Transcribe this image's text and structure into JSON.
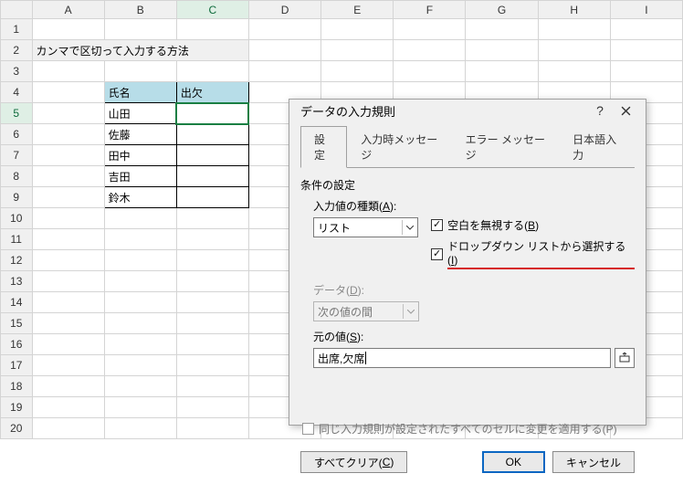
{
  "columns": [
    "A",
    "B",
    "C",
    "D",
    "E",
    "F",
    "G",
    "H",
    "I"
  ],
  "rows": [
    "1",
    "2",
    "3",
    "4",
    "5",
    "6",
    "7",
    "8",
    "9",
    "10",
    "11",
    "12",
    "13",
    "14",
    "15",
    "16",
    "17",
    "18",
    "19",
    "20"
  ],
  "title_cell": "カンマで区切って入力する方法",
  "table": {
    "headers": {
      "name": "氏名",
      "attend": "出欠"
    },
    "rows": [
      "山田",
      "佐藤",
      "田中",
      "吉田",
      "鈴木"
    ]
  },
  "active_col": "C",
  "active_row": "5",
  "dialog": {
    "title": "データの入力規則",
    "help": "?",
    "tabs": [
      "設定",
      "入力時メッセージ",
      "エラー メッセージ",
      "日本語入力"
    ],
    "active_tab": 0,
    "section": "条件の設定",
    "allow_label": "入力値の種類(",
    "allow_key": "A",
    "allow_label_tail": "):",
    "allow_value": "リスト",
    "data_label": "データ(",
    "data_key": "D",
    "data_label_tail": "):",
    "data_value": "次の値の間",
    "ignore_blank_label": "空白を無視する(",
    "ignore_blank_key": "B",
    "ignore_blank_tail": ")",
    "dropdown_label": "ドロップダウン リストから選択する(",
    "dropdown_key": "I",
    "dropdown_tail": ")",
    "source_label": "元の値(",
    "source_key": "S",
    "source_tail": "):",
    "source_value": "出席,欠席",
    "apply_label": "同じ入力規則が設定されたすべてのセルに変更を適用する(P)",
    "clear_btn": "すべてクリア(",
    "clear_key": "C",
    "clear_tail": ")",
    "ok": "OK",
    "cancel": "キャンセル"
  }
}
